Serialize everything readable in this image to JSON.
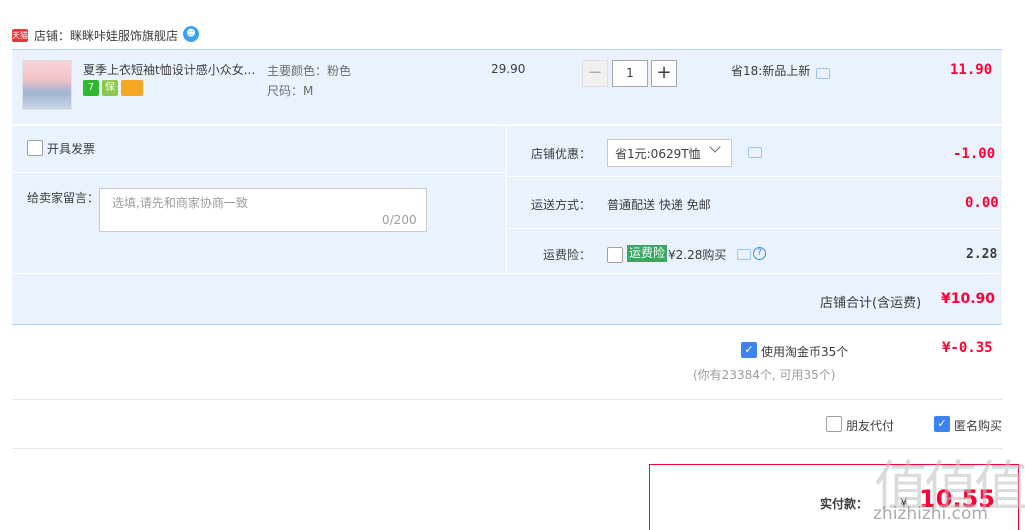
{
  "store": {
    "badge": "天猫",
    "name": "店铺：眯眯咔娃服饰旗舰店",
    "ww_icon": "ww-chat-icon"
  },
  "item": {
    "title": "夏季上衣短袖t恤设计感小众女...",
    "service_icons": [
      "7",
      "保",
      "card"
    ],
    "sku_color": "主要颜色：粉色",
    "sku_size": "尺码：M",
    "unit_price": "29.90",
    "quantity": "1",
    "minus": "−",
    "plus": "+",
    "promo": "省18:新品上新",
    "total": "11.90"
  },
  "options": {
    "invoice_label": "开具发票",
    "message_label": "给卖家留言：",
    "message_placeholder": "选填,请先和商家协商一致",
    "message_count": "0/200",
    "shop_discount_label": "店铺优惠：",
    "coupon_selected": "省1元:0629T恤",
    "shop_discount_amount": "-1.00",
    "shipping_label": "运送方式：",
    "shipping_method": "普通配送 快递 免邮",
    "shipping_fee": "0.00",
    "insurance_label": "运费险：",
    "insurance_badge": "运费险",
    "insurance_price": "¥2.28购买",
    "insurance_amount": "2.28"
  },
  "shop_total": {
    "label": "店铺合计(含运费)",
    "amount": "¥10.90"
  },
  "coin": {
    "label": "使用淘金币35个",
    "amount": "¥-0.35",
    "note": "(你有23384个, 可用35个)"
  },
  "extras": {
    "friend_pay_label": "朋友代付",
    "anonymous_label": "匿名购买"
  },
  "payment": {
    "label": "实付款：",
    "currency": "¥",
    "amount": "10.55"
  },
  "watermark": {
    "big": "值值值",
    "small": "zhizhizhi.com"
  },
  "colors": {
    "accent_red": "#ff0036",
    "panel_blue": "#eaf3fd",
    "checkbox_blue": "#3d82f0",
    "insurance_green": "#3ca560"
  }
}
